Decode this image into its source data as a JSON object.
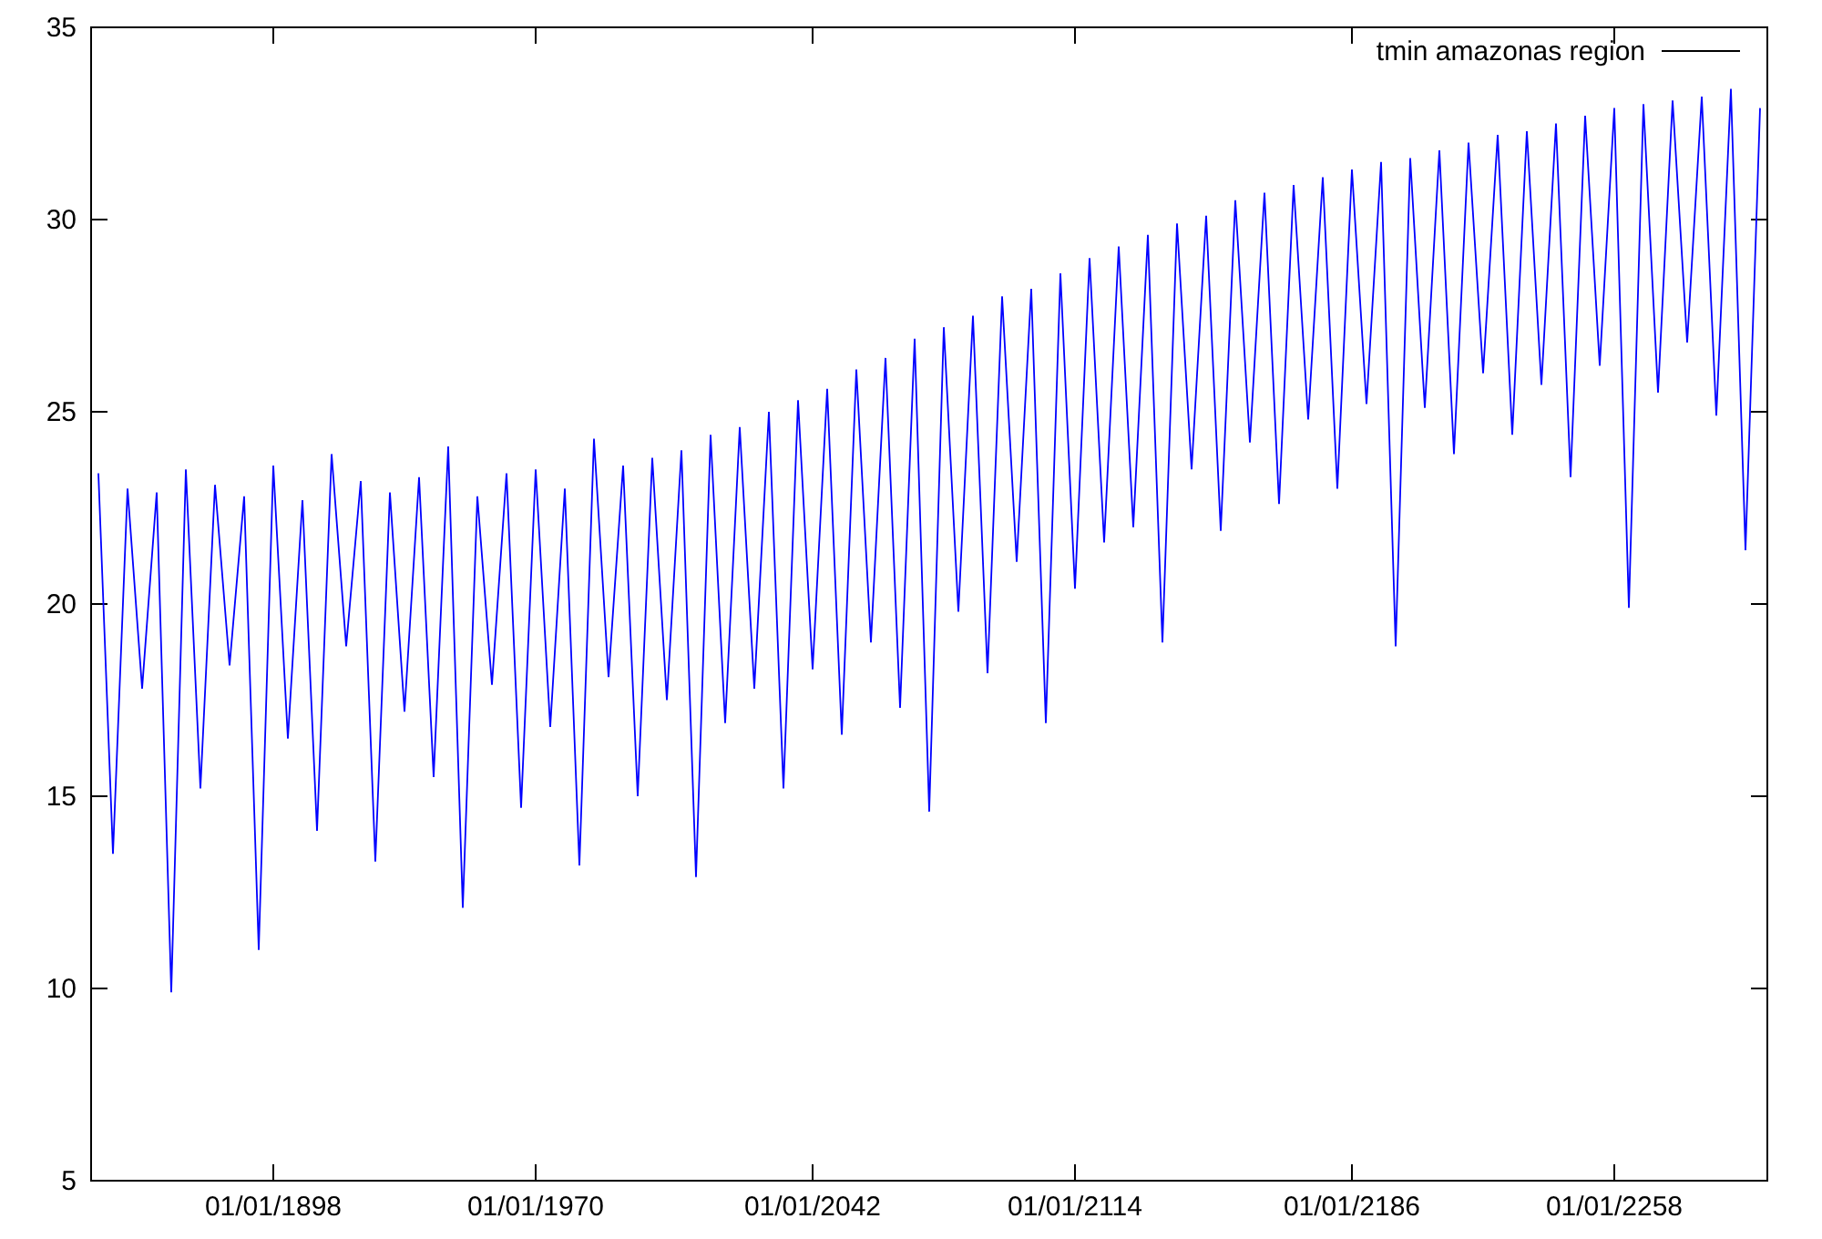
{
  "chart": {
    "chart_data": {
      "type": "line",
      "categories": [
        null,
        null,
        null,
        null,
        null,
        null,
        null,
        null,
        null,
        null,
        null,
        null,
        "01/01/1898",
        null,
        null,
        null,
        null,
        null,
        null,
        null,
        null,
        null,
        null,
        null,
        null,
        null,
        null,
        null,
        null,
        null,
        "01/01/1970",
        null,
        null,
        null,
        null,
        null,
        null,
        null,
        null,
        null,
        null,
        null,
        null,
        null,
        null,
        null,
        null,
        null,
        null,
        "01/01/2042",
        null,
        null,
        null,
        null,
        null,
        null,
        null,
        null,
        null,
        null,
        null,
        null,
        null,
        null,
        null,
        null,
        null,
        "01/01/2114",
        null,
        null,
        null,
        null,
        null,
        null,
        null,
        null,
        null,
        null,
        null,
        null,
        null,
        null,
        null,
        null,
        null,
        null,
        "01/01/2186",
        null,
        null,
        null,
        null,
        null,
        null,
        null,
        null,
        null,
        null,
        null,
        null,
        null,
        null,
        null,
        null,
        null,
        "01/01/2258",
        null,
        null,
        null,
        null,
        null,
        null,
        null,
        null,
        null,
        null
      ],
      "series": [
        {
          "name": "tmin amazonas region",
          "color": "#0000ff",
          "values": [
            23.4,
            13.5,
            23.0,
            17.8,
            22.9,
            9.9,
            23.5,
            15.2,
            23.1,
            18.4,
            22.8,
            11.0,
            23.6,
            16.5,
            22.7,
            14.1,
            23.9,
            18.9,
            23.2,
            13.3,
            22.9,
            17.2,
            23.3,
            15.5,
            24.1,
            12.1,
            22.8,
            17.9,
            23.4,
            14.7,
            23.5,
            16.8,
            23.0,
            13.2,
            24.3,
            18.1,
            23.6,
            15.0,
            23.8,
            17.5,
            24.0,
            12.9,
            24.4,
            16.9,
            24.6,
            17.8,
            25.0,
            15.2,
            25.3,
            18.3,
            25.6,
            16.6,
            26.1,
            19.0,
            26.4,
            17.3,
            26.9,
            14.6,
            27.2,
            19.8,
            27.5,
            18.2,
            28.0,
            21.1,
            28.2,
            16.9,
            28.6,
            20.4,
            29.0,
            21.6,
            29.3,
            22.0,
            29.6,
            19.0,
            29.9,
            23.5,
            30.1,
            21.9,
            30.5,
            24.2,
            30.7,
            22.6,
            30.9,
            24.8,
            31.1,
            23.0,
            31.3,
            25.2,
            31.5,
            18.9,
            31.6,
            25.1,
            31.8,
            23.9,
            32.0,
            26.0,
            32.2,
            24.4,
            32.3,
            25.7,
            32.5,
            23.3,
            32.7,
            26.2,
            32.9,
            19.9,
            33.0,
            25.5,
            33.1,
            26.8,
            33.2,
            24.9,
            33.4,
            21.4,
            32.9
          ]
        }
      ],
      "ylim": [
        5,
        35
      ],
      "yticks": [
        5,
        10,
        15,
        20,
        25,
        30,
        35
      ]
    }
  }
}
